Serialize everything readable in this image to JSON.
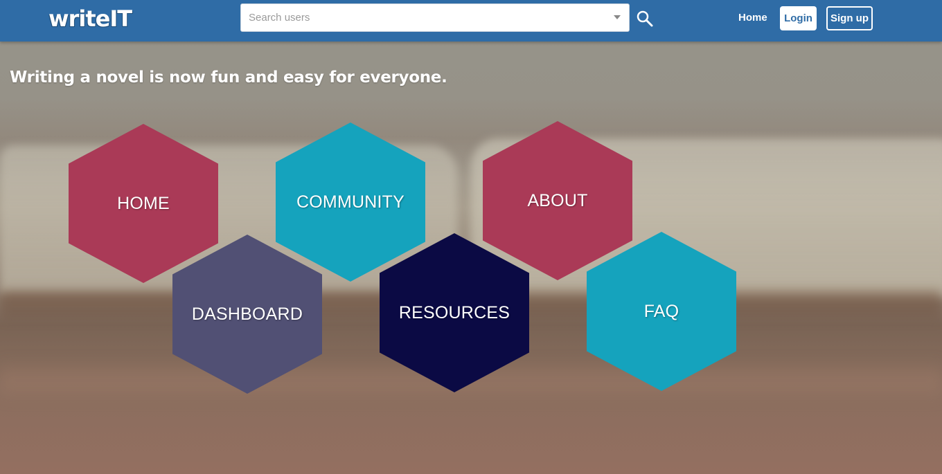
{
  "header": {
    "logo": "writeIT",
    "search": {
      "placeholder": "Search users",
      "value": ""
    },
    "nav": {
      "home": "Home",
      "login": "Login",
      "signup": "Sign up"
    }
  },
  "hero": {
    "tagline": "Writing a novel is now fun and easy for everyone."
  },
  "tiles": [
    {
      "label": "HOME",
      "color": "#aa3a57"
    },
    {
      "label": "COMMUNITY",
      "color": "#15a3bd"
    },
    {
      "label": "ABOUT",
      "color": "#aa3a57"
    },
    {
      "label": "DASHBOARD",
      "color": "#515074"
    },
    {
      "label": "RESOURCES",
      "color": "#0b0a44"
    },
    {
      "label": "FAQ",
      "color": "#15a3bd"
    }
  ],
  "colors": {
    "navbar": "#2f6ca6",
    "text_on_dark": "#ffffff"
  },
  "icons": {
    "search": "search-icon",
    "dropdown": "chevron-down-icon"
  }
}
